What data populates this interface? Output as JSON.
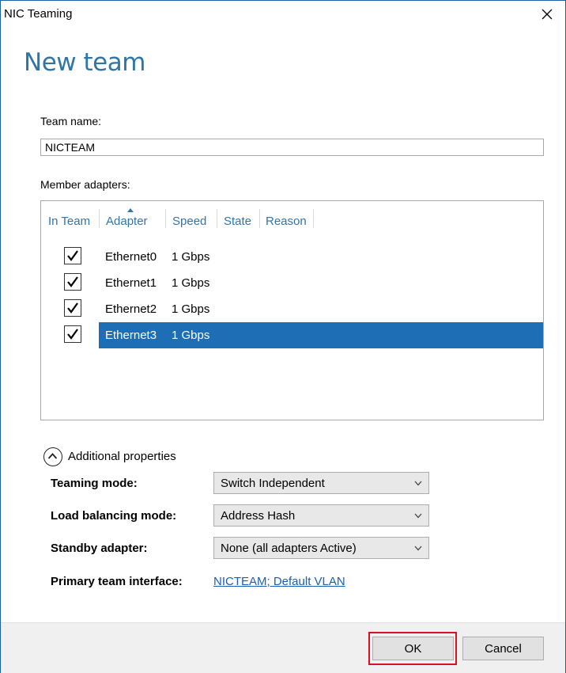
{
  "window": {
    "title": "NIC Teaming",
    "heading": "New team"
  },
  "team_name": {
    "label": "Team name:",
    "value": "NICTEAM"
  },
  "member_adapters": {
    "label": "Member adapters:",
    "columns": [
      "In Team",
      "Adapter",
      "Speed",
      "State",
      "Reason"
    ],
    "sorted_column": "Adapter",
    "rows": [
      {
        "in_team": true,
        "adapter": "Ethernet0",
        "speed": "1 Gbps",
        "selected": false
      },
      {
        "in_team": true,
        "adapter": "Ethernet1",
        "speed": "1 Gbps",
        "selected": false
      },
      {
        "in_team": true,
        "adapter": "Ethernet2",
        "speed": "1 Gbps",
        "selected": false
      },
      {
        "in_team": true,
        "adapter": "Ethernet3",
        "speed": "1 Gbps",
        "selected": true
      }
    ]
  },
  "additional_properties": {
    "label": "Additional properties",
    "expanded": true,
    "teaming_mode": {
      "label": "Teaming mode:",
      "value": "Switch Independent"
    },
    "load_balancing_mode": {
      "label": "Load balancing mode:",
      "value": "Address Hash"
    },
    "standby_adapter": {
      "label": "Standby adapter:",
      "value": "None (all adapters Active)"
    },
    "primary_team_interface": {
      "label": "Primary team interface:",
      "link_text": "NICTEAM; Default VLAN"
    }
  },
  "buttons": {
    "ok": "OK",
    "cancel": "Cancel"
  },
  "colors": {
    "accent": "#2f76a8",
    "selection": "#1e6eb5",
    "highlight_box": "#d6141f",
    "link": "#1a5fb4"
  }
}
